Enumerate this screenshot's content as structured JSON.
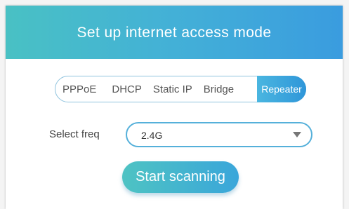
{
  "header": {
    "title": "Set up internet access mode"
  },
  "modes": {
    "tabs": [
      {
        "label": "PPPoE"
      },
      {
        "label": "DHCP"
      },
      {
        "label": "Static IP"
      },
      {
        "label": "Bridge"
      },
      {
        "label": "Repeater"
      }
    ],
    "selected": "Repeater"
  },
  "freq": {
    "label": "Select freq",
    "value": "2.4G"
  },
  "scan": {
    "label": "Start scanning"
  },
  "colors": {
    "accent": "#3a9cdf",
    "header_start": "#49c1c4",
    "header_end": "#3a9cdf"
  }
}
